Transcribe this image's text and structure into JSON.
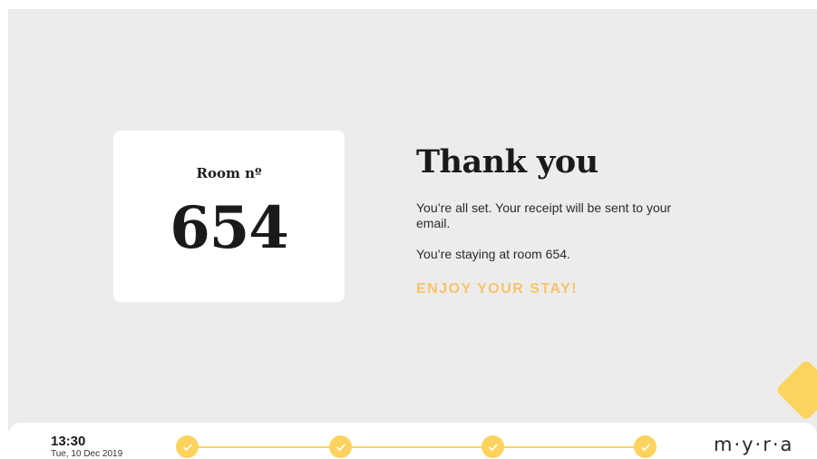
{
  "room_card": {
    "label": "Room nº",
    "number": "654"
  },
  "content": {
    "title": "Thank you",
    "message_receipt": "You’re all set. Your receipt will be sent to your email.",
    "message_room": "You’re staying at room 654.",
    "enjoy": "ENJOY YOUR STAY!"
  },
  "footer": {
    "time": "13:30",
    "date": "Tue, 10 Dec 2019",
    "steps": [
      {
        "state": "completed",
        "icon": "check-icon"
      },
      {
        "state": "completed",
        "icon": "check-icon"
      },
      {
        "state": "completed",
        "icon": "check-icon"
      },
      {
        "state": "completed",
        "icon": "check-icon"
      }
    ],
    "logo": "m·y·r·a"
  },
  "colors": {
    "accent": "#fcd35e",
    "enjoy_text": "#f6c46b",
    "background": "#ececeb"
  }
}
